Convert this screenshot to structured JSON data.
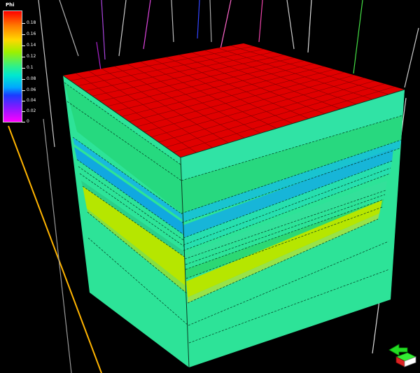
{
  "legend": {
    "title": "Phi",
    "ticks": [
      "0.18",
      "0.16",
      "0.14",
      "0.12",
      "0.1",
      "0.08",
      "0.06",
      "0.04",
      "0.02",
      "0"
    ]
  },
  "colors": {
    "top_face": "#e00000",
    "matrix": "#2ee39a",
    "band_blue": "#17b5d8",
    "band_yellow": "#b6e600",
    "band_green": "#2cd874",
    "background": "#000000"
  },
  "icons": {
    "orientation": "orientation-gizmo-icon"
  }
}
